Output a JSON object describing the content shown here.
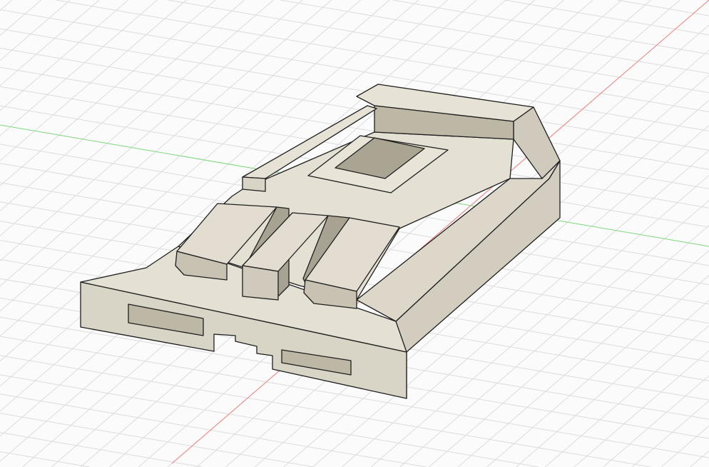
{
  "viewport": {
    "background": "#fbfbfb",
    "grid_color": "#dcdcdc",
    "x_axis_color": "#f08080",
    "y_axis_color": "#7fdc7f"
  },
  "model": {
    "top_color": "#e4e0d3",
    "front_color": "#d8d4c6",
    "shade_color": "#b9b3a2",
    "edge_color": "#1e1e1e"
  }
}
